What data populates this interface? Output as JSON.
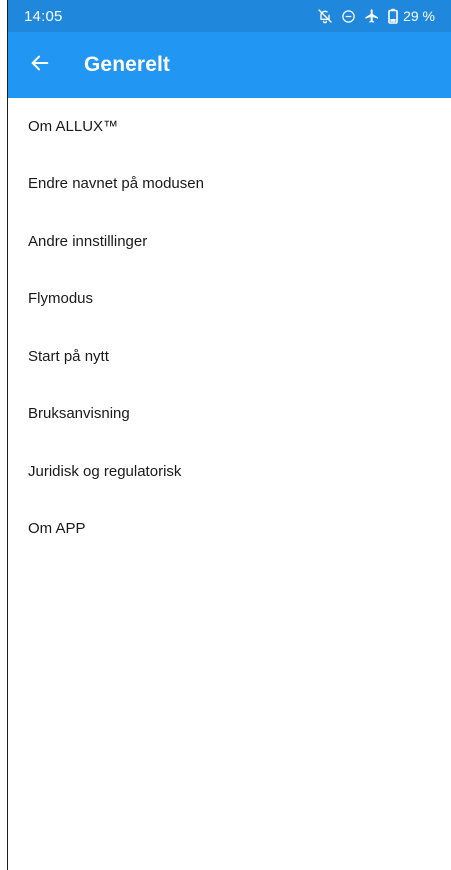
{
  "status_bar": {
    "time": "14:05",
    "battery": "29 %",
    "icons": [
      "notifications-off-icon",
      "do-not-disturb-icon",
      "airplane-icon",
      "battery-icon"
    ],
    "color": "#1f88dc"
  },
  "app_bar": {
    "title": "Generelt",
    "back_icon": "arrow-left-icon",
    "color": "#2196f3"
  },
  "menu": {
    "items": [
      {
        "label": "Om ALLUX™"
      },
      {
        "label": "Endre navnet på modusen"
      },
      {
        "label": "Andre innstillinger"
      },
      {
        "label": "Flymodus"
      },
      {
        "label": "Start på nytt"
      },
      {
        "label": "Bruksanvisning"
      },
      {
        "label": "Juridisk og regulatorisk"
      },
      {
        "label": "Om APP"
      }
    ]
  }
}
